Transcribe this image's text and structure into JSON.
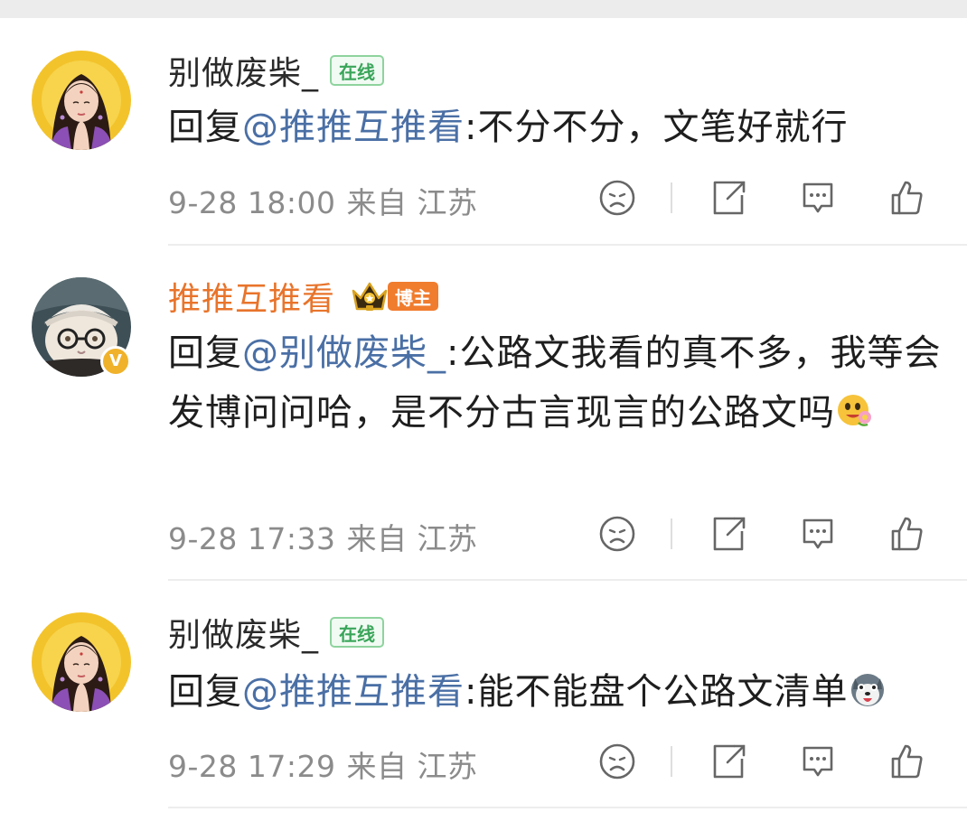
{
  "comments": [
    {
      "username": "别做废柴_",
      "badge": "在线",
      "reply_prefix": "回复",
      "mention": "@推推互推看",
      "text": ":不分不分，文笔好就行",
      "time": "9-28 18:00",
      "location": "来自 江苏"
    },
    {
      "username": "推推互推看",
      "badge": "博主",
      "reply_prefix": "回复",
      "mention": "@别做废柴_",
      "text": ":公路文我看的真不多，我等会发博问问哈，是不分古言现言的公路文吗",
      "emoji": "happy-flower-emoji",
      "time": "9-28 17:33",
      "location": "来自 江苏",
      "verified_badge": "V"
    },
    {
      "username": "别做废柴_",
      "badge": "在线",
      "reply_prefix": "回复",
      "mention": "@推推互推看",
      "text": ":能不能盘个公路文清单",
      "emoji": "husky-emoji",
      "time": "9-28 17:29",
      "location": "来自 江苏"
    }
  ],
  "colors": {
    "mention": "#4a6fa5",
    "blogger_name": "#e8742b",
    "online_badge": "#3aa55a",
    "blogger_badge": "#f07c2e",
    "meta_text": "#8b8b8b"
  },
  "icons": [
    "dislike-face-icon",
    "share-icon",
    "comment-icon",
    "like-thumb-icon"
  ]
}
